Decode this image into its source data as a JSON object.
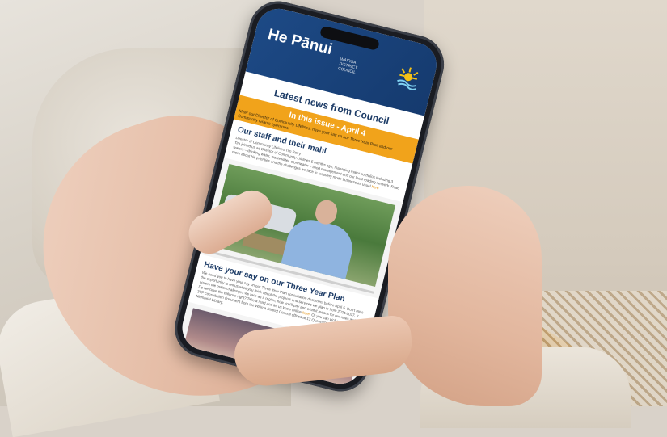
{
  "newsletter": {
    "masthead_title": "He Pānui",
    "masthead_sub": "WAIROA DISTRICT COUNCIL",
    "latest_heading": "Latest news from Council",
    "issue_heading": "In this issue - April 4",
    "issue_desc": "Meet our Director of Community Lifelines, have your say on our Three Year Plan and our Community Grants open now.",
    "section1_title": "Our staff and their mahi",
    "section1_byline": "Director of Community Lifelines Tim Barry",
    "section1_body": "Tim joined us as Director of Community Lifelines 5 months ago, managing major portfolios including 3 waters – drinking water, wastewater, stormwater – flood management and our local roading network. Read more about his priorities and the challenges we face in recovery mode business as usual",
    "section1_link": "here",
    "section2_title": "Have your say on our Three Year Plan",
    "section2_body": "We need you to have your say on our Three Year Plan consultation document before April 5. Don't miss the opportunity to tell us what you think about the projects and services we plan in from 2024-2027. It covers the major challenges we face as a region, how you'll pay and what it means for our rates and debt. Do we have the balance right? Take a read and let us know online",
    "section2_link": "here",
    "section2_body2": "Or you can pick up a copy of the 3YP consultation document from the Wairoa District Council offices at 13 Queen Street or Wairoa Memorial Library."
  },
  "colors": {
    "banner": "#1d4a86",
    "accent": "#f1a31b",
    "heading": "#1c3b66"
  }
}
